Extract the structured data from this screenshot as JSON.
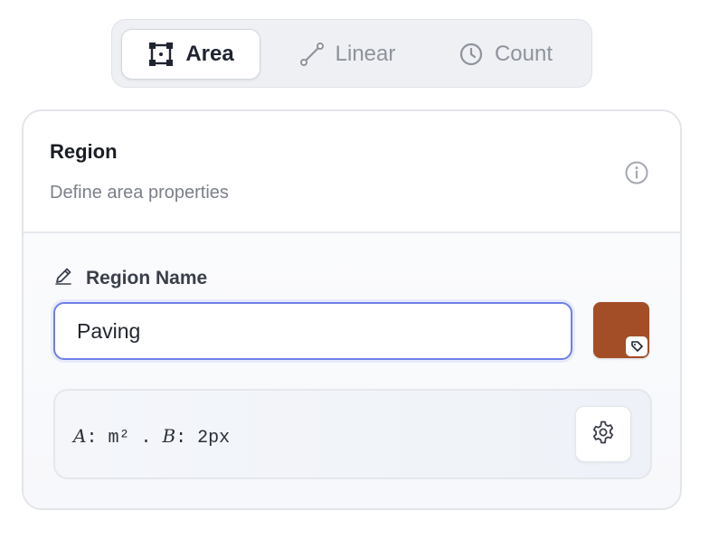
{
  "tabs": [
    {
      "label": "Area",
      "icon": "area-square-icon",
      "active": true
    },
    {
      "label": "Linear",
      "icon": "line-segment-icon",
      "active": false
    },
    {
      "label": "Count",
      "icon": "clock-icon",
      "active": false
    }
  ],
  "card": {
    "title": "Region",
    "subtitle": "Define area properties",
    "info_icon": "info-icon"
  },
  "region_name": {
    "label": "Region Name",
    "label_icon": "pencil-icon",
    "value": "Paving"
  },
  "color": {
    "swatch_hex": "#a34e27",
    "badge_icon": "tag-icon"
  },
  "formula": {
    "var_a": "A",
    "part_a": ": m² . ",
    "var_b": "B",
    "part_b": ": 2px",
    "settings_icon": "gear-icon"
  },
  "accent": "#6f7fe6"
}
